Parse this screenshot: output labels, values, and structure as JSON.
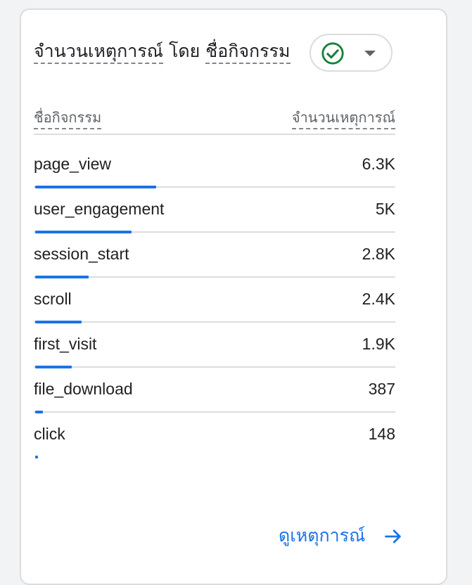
{
  "card": {
    "title_part1": "จำนวนเหตุการณ์",
    "title_part2": "โดย",
    "title_part3": "ชื่อกิจกรรม",
    "filter": {
      "status_icon": "check-circle-icon",
      "dropdown_icon": "caret-down-icon"
    }
  },
  "table": {
    "col_name": "ชื่อกิจกรรม",
    "col_count": "จำนวนเหตุการณ์",
    "rows": [
      {
        "name": "page_view",
        "value": "6.3K",
        "count": 6300
      },
      {
        "name": "user_engagement",
        "value": "5K",
        "count": 5000
      },
      {
        "name": "session_start",
        "value": "2.8K",
        "count": 2800
      },
      {
        "name": "scroll",
        "value": "2.4K",
        "count": 2400
      },
      {
        "name": "first_visit",
        "value": "1.9K",
        "count": 1900
      },
      {
        "name": "file_download",
        "value": "387",
        "count": 387
      },
      {
        "name": "click",
        "value": "148",
        "count": 148
      }
    ]
  },
  "footer": {
    "view_link": "ดูเหตุการณ์",
    "view_icon": "arrow-right-icon"
  },
  "colors": {
    "accent": "#1a73e8",
    "check": "#188038"
  }
}
